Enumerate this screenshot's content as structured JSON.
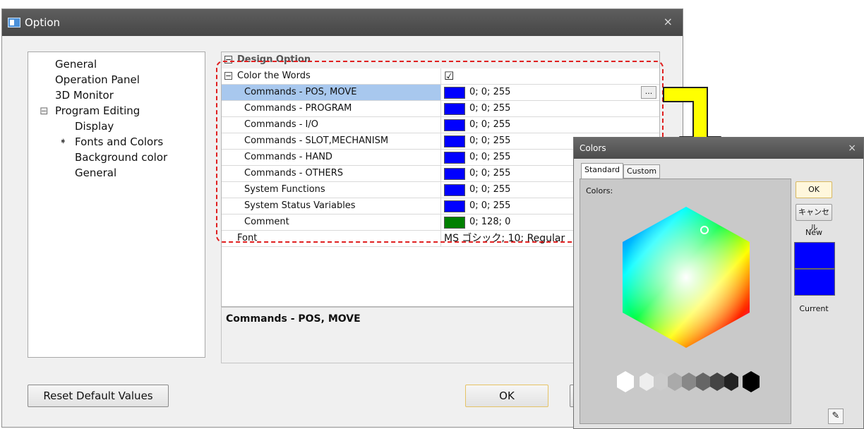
{
  "option_window": {
    "title": "Option",
    "close_glyph": "×",
    "tree": [
      {
        "label": "General",
        "indent": 0
      },
      {
        "label": "Operation Panel",
        "indent": 0
      },
      {
        "label": "3D Monitor",
        "indent": 0
      },
      {
        "label": "Program Editing",
        "indent": 0,
        "expander": "⊟"
      },
      {
        "label": "Display",
        "indent": 1
      },
      {
        "label": "Fonts and Colors",
        "indent": 1,
        "selected": true
      },
      {
        "label": "Background color",
        "indent": 1
      },
      {
        "label": "General",
        "indent": 1
      }
    ],
    "grid": {
      "category": "Design Option",
      "color_words_label": "Color the Words",
      "color_words_checked": "☑",
      "rows": [
        {
          "name": "Commands - POS, MOVE",
          "value": "0; 0; 255",
          "color": "#0000ff",
          "selected": true
        },
        {
          "name": "Commands - PROGRAM",
          "value": "0; 0; 255",
          "color": "#0000ff"
        },
        {
          "name": "Commands - I/O",
          "value": "0; 0; 255",
          "color": "#0000ff"
        },
        {
          "name": "Commands - SLOT,MECHANISM",
          "value": "0; 0; 255",
          "color": "#0000ff"
        },
        {
          "name": "Commands - HAND",
          "value": "0; 0; 255",
          "color": "#0000ff"
        },
        {
          "name": "Commands - OTHERS",
          "value": "0; 0; 255",
          "color": "#0000ff"
        },
        {
          "name": "System Functions",
          "value": "0; 0; 255",
          "color": "#0000ff"
        },
        {
          "name": "System Status Variables",
          "value": "0; 0; 255",
          "color": "#0000ff"
        },
        {
          "name": "Comment",
          "value": "0; 128; 0",
          "color": "#008000"
        }
      ],
      "font_label": "Font",
      "font_value": "MS ゴシック; 10; Regular",
      "ellipsis": "..."
    },
    "description_title": "Commands - POS, MOVE",
    "reset_button": "Reset Default Values",
    "ok_button": "OK"
  },
  "colors_dialog": {
    "title": "Colors",
    "close_glyph": "×",
    "tabs": [
      "Standard",
      "Custom"
    ],
    "panel_label": "Colors:",
    "ok_button": "OK",
    "cancel_button": "キャンセル",
    "new_label": "New",
    "current_label": "Current",
    "new_color": "#0000ff",
    "current_color": "#0000ff"
  },
  "colors": {
    "highlight_outline": "#e02020",
    "arrow_fill": "#ffff00",
    "selection_bg": "#a8c8ee"
  }
}
